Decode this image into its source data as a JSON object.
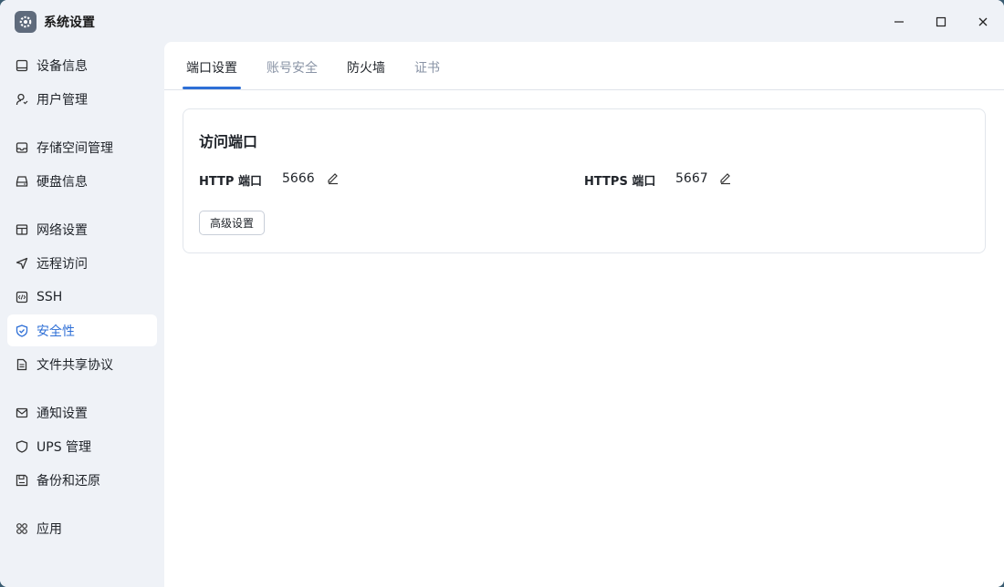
{
  "window": {
    "title": "系统设置",
    "controls": [
      "minimize",
      "maximize",
      "close"
    ]
  },
  "sidebar": {
    "items": [
      {
        "label": "设备信息",
        "icon": "monitor-icon"
      },
      {
        "label": "用户管理",
        "icon": "user-icon"
      },
      {
        "label": "存储空间管理",
        "icon": "storage-icon"
      },
      {
        "label": "硬盘信息",
        "icon": "disk-icon"
      },
      {
        "label": "网络设置",
        "icon": "network-icon"
      },
      {
        "label": "远程访问",
        "icon": "send-icon"
      },
      {
        "label": "SSH",
        "icon": "code-icon"
      },
      {
        "label": "安全性",
        "icon": "shield-check-icon",
        "active": true
      },
      {
        "label": "文件共享协议",
        "icon": "document-icon"
      },
      {
        "label": "通知设置",
        "icon": "mail-icon"
      },
      {
        "label": "UPS 管理",
        "icon": "shield-icon"
      },
      {
        "label": "备份和还原",
        "icon": "save-icon"
      },
      {
        "label": "应用",
        "icon": "apps-grid-icon"
      }
    ]
  },
  "tabs": [
    {
      "label": "端口设置",
      "active": true
    },
    {
      "label": "账号安全"
    },
    {
      "label": "防火墙"
    },
    {
      "label": "证书"
    }
  ],
  "card": {
    "title": "访问端口",
    "http_label": "HTTP 端口",
    "http_value": "5666",
    "https_label": "HTTPS 端口",
    "https_value": "5667",
    "advanced_button": "高级设置"
  },
  "colors": {
    "accent": "#2e6fd6",
    "sidebar_bg": "#eff2f7",
    "content_bg": "#ffffff"
  }
}
